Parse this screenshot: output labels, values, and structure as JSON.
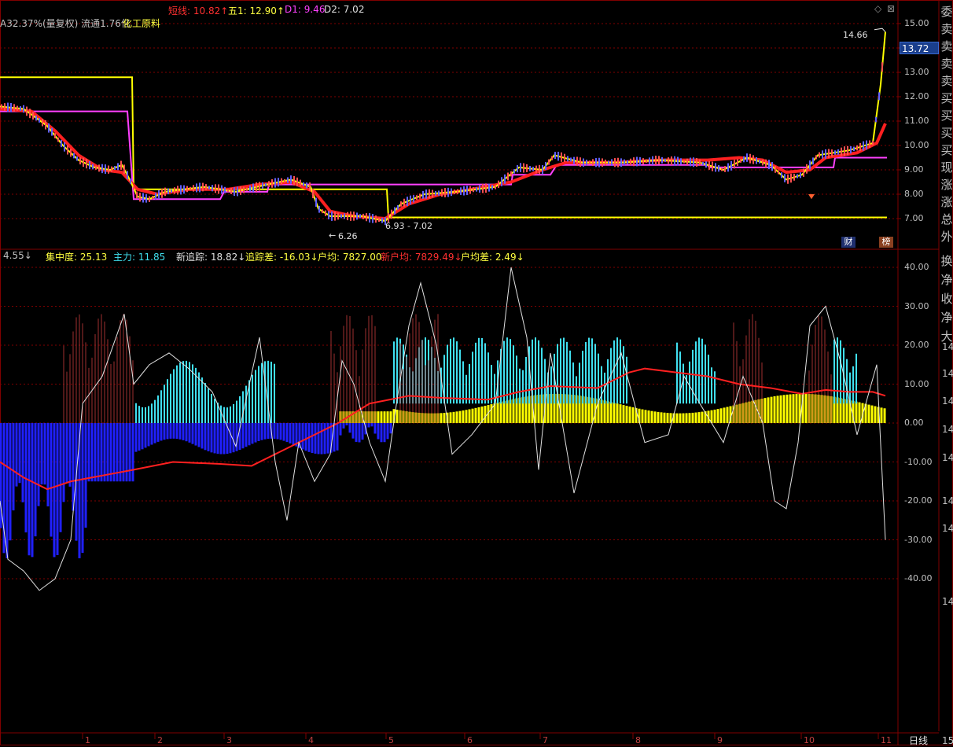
{
  "header": {
    "short_line": "短线: 10.82↑",
    "five": "五1: 12.90↑",
    "d1": "D1: 9.46",
    "d2": "D2: 7.02",
    "info": "A32.37%(量复权) 流通1.76亿",
    "industry": "化工原料"
  },
  "indicator_bar": {
    "v1": "4.55↓",
    "v2": "集中度: 25.13",
    "v3": "主力: 11.85",
    "new_track": "新追踪: 18.82↓",
    "track_diff": "追踪差: -16.03↓",
    "hu_jun": "户均: 7827.00",
    "new_hu_jun": "新户均: 7829.49↓",
    "hu_jun_diff": "户均差: 2.49↓"
  },
  "price_axis": [
    "15.00",
    "14.00",
    "13.00",
    "12.00",
    "11.00",
    "10.00",
    "9.00",
    "8.00",
    "7.00"
  ],
  "current_price": "13.72",
  "annotations": {
    "high": "14.66",
    "low": "6.26",
    "range": "6.93 - 7.02"
  },
  "ind_axis": [
    "40.00",
    "30.00",
    "20.00",
    "10.00",
    "0.00",
    "-10.00",
    "-20.00",
    "-30.00",
    "-40.00"
  ],
  "right_col_top": [
    "委",
    "卖",
    "卖",
    "卖",
    "卖",
    "买",
    "买",
    "买",
    "买",
    "现",
    "涨",
    "涨",
    "总",
    "外"
  ],
  "right_col_bottom": [
    "换",
    "净",
    "收",
    "净",
    "大"
  ],
  "right_partial_numbers": [
    "14",
    "14",
    "14",
    "14",
    "14",
    "14",
    "14",
    "14",
    "15"
  ],
  "buttons": {
    "cai": "财",
    "bang": "榜"
  },
  "date_ticks": [
    "1",
    "2",
    "3",
    "4",
    "5",
    "6",
    "7",
    "8",
    "9",
    "10",
    "11"
  ],
  "period": "日线",
  "colors": {
    "red": "#ff2020",
    "yellow": "#ffff00",
    "magenta": "#ff40ff",
    "cyan": "#40e0f0",
    "blue": "#2020ff",
    "grid": "#800000"
  }
}
